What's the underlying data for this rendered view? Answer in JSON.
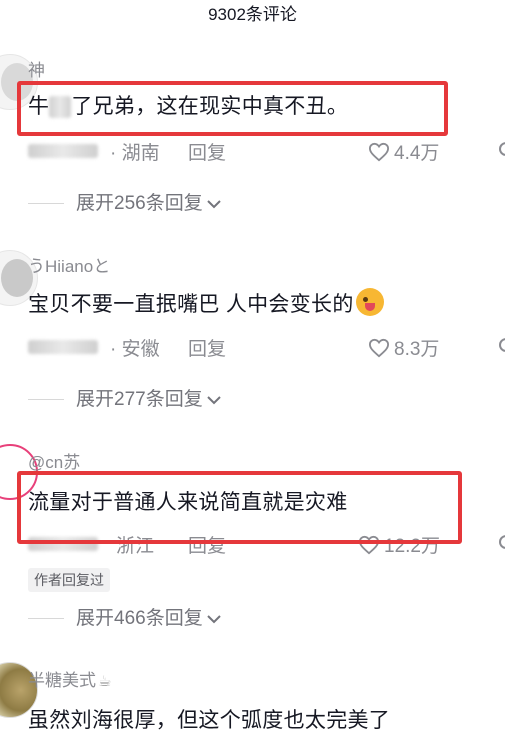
{
  "header": {
    "title": "9302条评论"
  },
  "comments": [
    {
      "username": "神",
      "text_a": "牛",
      "text_b": "了兄弟，这在现实中真不丑。",
      "location": "· 湖南",
      "reply": "回复",
      "likes": "4.4万",
      "expand": "展开256条回复",
      "highlighted": true
    },
    {
      "username": "うHiianoと",
      "text": "宝贝不要一直抿嘴巴 人中会变长的",
      "emoji_icon": "winking-tongue-emoji",
      "location": "· 安徽",
      "reply": "回复",
      "likes": "8.3万",
      "expand": "展开277条回复",
      "highlighted": false
    },
    {
      "username": "@cn苏",
      "text": "流量对于普通人来说简直就是灾难",
      "location": "浙江",
      "reply": "回复",
      "likes": "12.2万",
      "badge": "作者回复过",
      "expand": "展开466条回复",
      "highlighted": true
    },
    {
      "username": "半糖美式",
      "username_icon": "coffee-cup-icon",
      "text": "虽然刘海很厚，但这个弧度也太完美了",
      "highlighted": false
    }
  ],
  "colors": {
    "highlight_box": "#e5383b",
    "secondary_text": "#8a8b91",
    "primary_text": "#161823",
    "avatar_ring": "#e8407a"
  }
}
